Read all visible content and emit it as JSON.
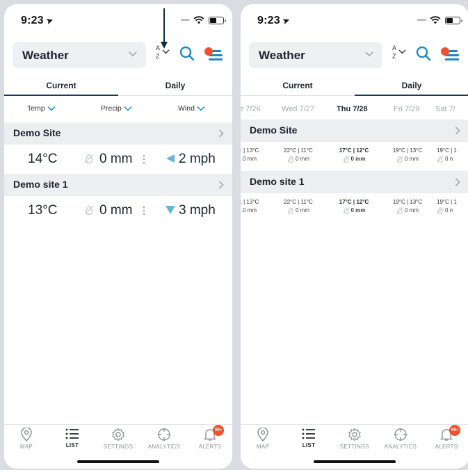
{
  "status": {
    "time": "9:23"
  },
  "header": {
    "title": "Weather",
    "sort_a": "A",
    "sort_z": "Z"
  },
  "tabs": [
    {
      "label": "Current"
    },
    {
      "label": "Daily"
    }
  ],
  "sort_columns": [
    {
      "label": "Temp"
    },
    {
      "label": "Precip"
    },
    {
      "label": "Wind"
    }
  ],
  "current_sites": [
    {
      "name": "Demo Site",
      "temp": "14°C",
      "precip": "0 mm",
      "wind": "2 mph"
    },
    {
      "name": "Demo site 1",
      "temp": "13°C",
      "precip": "0 mm",
      "wind": "3 mph"
    }
  ],
  "daily": {
    "days": [
      "e 7/26",
      "Wed 7/27",
      "Thu 7/28",
      "Fri 7/29",
      "Sat 7/"
    ],
    "selected_day": "Thu 7/28",
    "sites": [
      {
        "name": "Demo Site",
        "cells": [
          {
            "temp": ": | 13°C",
            "precip": "0 mm"
          },
          {
            "temp": "22°C | 11°C",
            "precip": "0 mm"
          },
          {
            "temp": "17°C | 12°C",
            "precip": "0 mm"
          },
          {
            "temp": "19°C | 13°C",
            "precip": "0 mm"
          },
          {
            "temp": "19°C | 1",
            "precip": "0 n"
          }
        ]
      },
      {
        "name": "Demo site 1",
        "cells": [
          {
            "temp": ": | 13°C",
            "precip": "0 mm"
          },
          {
            "temp": "22°C | 11°C",
            "precip": "0 mm"
          },
          {
            "temp": "17°C | 12°C",
            "precip": "0 mm"
          },
          {
            "temp": "19°C | 13°C",
            "precip": "0 mm"
          },
          {
            "temp": "19°C | 1",
            "precip": "0 n"
          }
        ]
      }
    ]
  },
  "nav": [
    {
      "label": "MAP",
      "icon": "map-pin-icon"
    },
    {
      "label": "LIST",
      "icon": "list-icon"
    },
    {
      "label": "SETTINGS",
      "icon": "gear-icon"
    },
    {
      "label": "ANALYTICS",
      "icon": "crosshair-icon"
    },
    {
      "label": "ALERTS",
      "icon": "bell-icon",
      "badge": "99+"
    }
  ],
  "colors": {
    "accent": "#1a8ac4",
    "alert": "#f0522c",
    "text": "#1b2430"
  }
}
